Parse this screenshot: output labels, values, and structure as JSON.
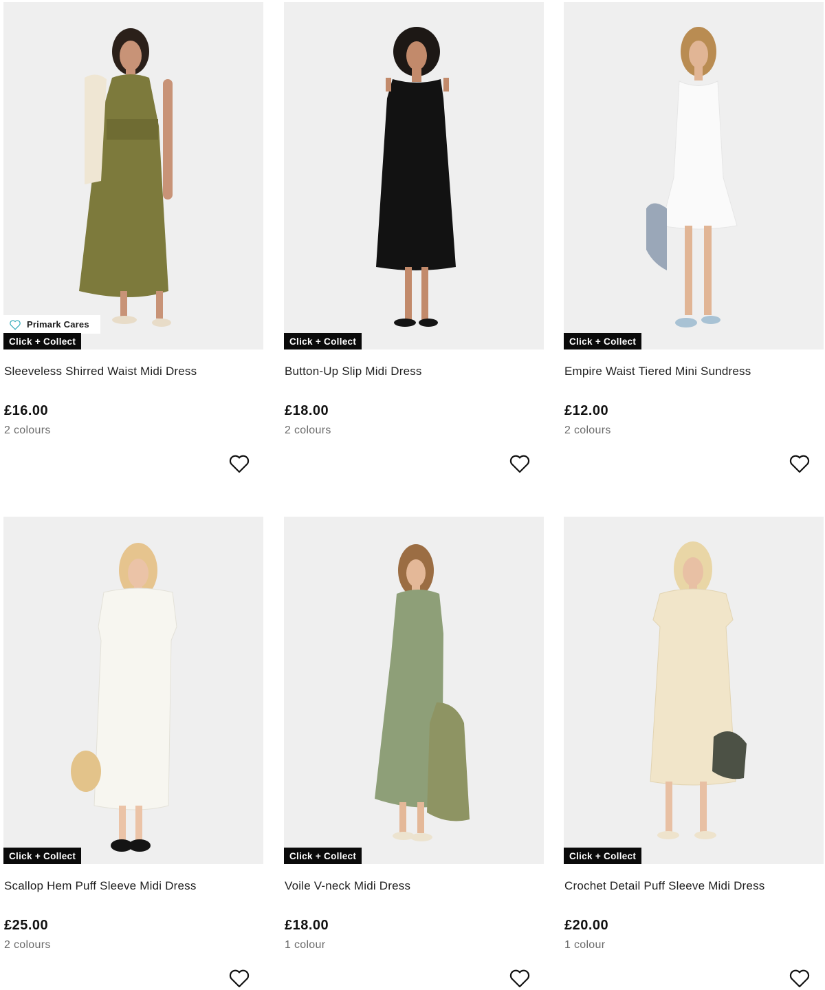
{
  "products": [
    {
      "title": "Sleeveless Shirred Waist Midi Dress",
      "price": "£16.00",
      "colours": "2 colours",
      "badge": "Click + Collect",
      "cares_badge": "Primark Cares",
      "dress_color": "#7d7a3c"
    },
    {
      "title": "Button-Up Slip Midi Dress",
      "price": "£18.00",
      "colours": "2 colours",
      "badge": "Click + Collect",
      "dress_color": "#121212"
    },
    {
      "title": "Empire Waist Tiered Mini Sundress",
      "price": "£12.00",
      "colours": "2 colours",
      "badge": "Click + Collect",
      "dress_color": "#fafafa"
    },
    {
      "title": "Scallop Hem Puff Sleeve Midi Dress",
      "price": "£25.00",
      "colours": "2 colours",
      "badge": "Click + Collect",
      "dress_color": "#f7f6f0"
    },
    {
      "title": "Voile V-neck Midi Dress",
      "price": "£18.00",
      "colours": "1 colour",
      "badge": "Click + Collect",
      "dress_color": "#8e9f78"
    },
    {
      "title": "Crochet Detail Puff Sleeve Midi Dress",
      "price": "£20.00",
      "colours": "1 colour",
      "badge": "Click + Collect",
      "dress_color": "#f1e5c9"
    }
  ],
  "icons": {
    "wishlist": "heart-outline-icon",
    "cares": "heart-outline-icon"
  },
  "colors": {
    "badge_bg": "#0a0a0a",
    "photo_bg": "#efefef",
    "cares_accent": "#2aa8b8"
  }
}
